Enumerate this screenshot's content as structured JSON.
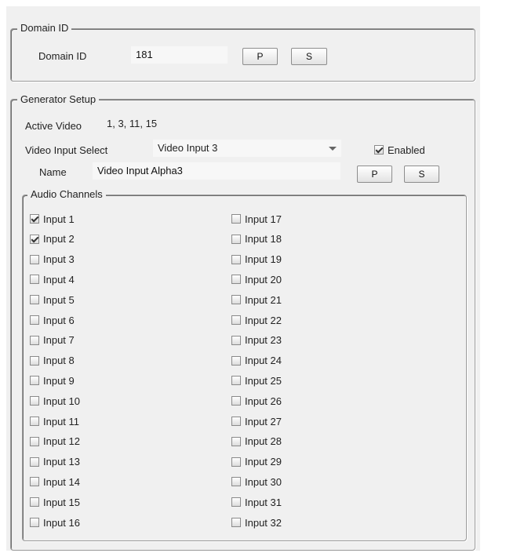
{
  "domain_group": {
    "legend": "Domain ID",
    "label": "Domain ID",
    "value": "181",
    "p_label": "P",
    "s_label": "S"
  },
  "generator": {
    "legend": "Generator Setup",
    "active_video_label": "Active Video",
    "active_video_value": "1, 3, 11, 15",
    "video_input_select_label": "Video Input Select",
    "video_input_selected": "Video Input 3",
    "enabled_label": "Enabled",
    "enabled_checked": true,
    "name_label": "Name",
    "name_value": "Video Input Alpha3",
    "p_label": "P",
    "s_label": "S"
  },
  "audio": {
    "legend": "Audio Channels",
    "inputs": [
      {
        "label": "Input 1",
        "checked": true
      },
      {
        "label": "Input 2",
        "checked": true
      },
      {
        "label": "Input 3",
        "checked": false
      },
      {
        "label": "Input 4",
        "checked": false
      },
      {
        "label": "Input 5",
        "checked": false
      },
      {
        "label": "Input 6",
        "checked": false
      },
      {
        "label": "Input 7",
        "checked": false
      },
      {
        "label": "Input 8",
        "checked": false
      },
      {
        "label": "Input 9",
        "checked": false
      },
      {
        "label": "Input 10",
        "checked": false
      },
      {
        "label": "Input 11",
        "checked": false
      },
      {
        "label": "Input 12",
        "checked": false
      },
      {
        "label": "Input 13",
        "checked": false
      },
      {
        "label": "Input 14",
        "checked": false
      },
      {
        "label": "Input 15",
        "checked": false
      },
      {
        "label": "Input 16",
        "checked": false
      },
      {
        "label": "Input 17",
        "checked": false
      },
      {
        "label": "Input 18",
        "checked": false
      },
      {
        "label": "Input 19",
        "checked": false
      },
      {
        "label": "Input 20",
        "checked": false
      },
      {
        "label": "Input 21",
        "checked": false
      },
      {
        "label": "Input 22",
        "checked": false
      },
      {
        "label": "Input 23",
        "checked": false
      },
      {
        "label": "Input 24",
        "checked": false
      },
      {
        "label": "Input 25",
        "checked": false
      },
      {
        "label": "Input 26",
        "checked": false
      },
      {
        "label": "Input 27",
        "checked": false
      },
      {
        "label": "Input 28",
        "checked": false
      },
      {
        "label": "Input 29",
        "checked": false
      },
      {
        "label": "Input 30",
        "checked": false
      },
      {
        "label": "Input 31",
        "checked": false
      },
      {
        "label": "Input 32",
        "checked": false
      }
    ]
  }
}
